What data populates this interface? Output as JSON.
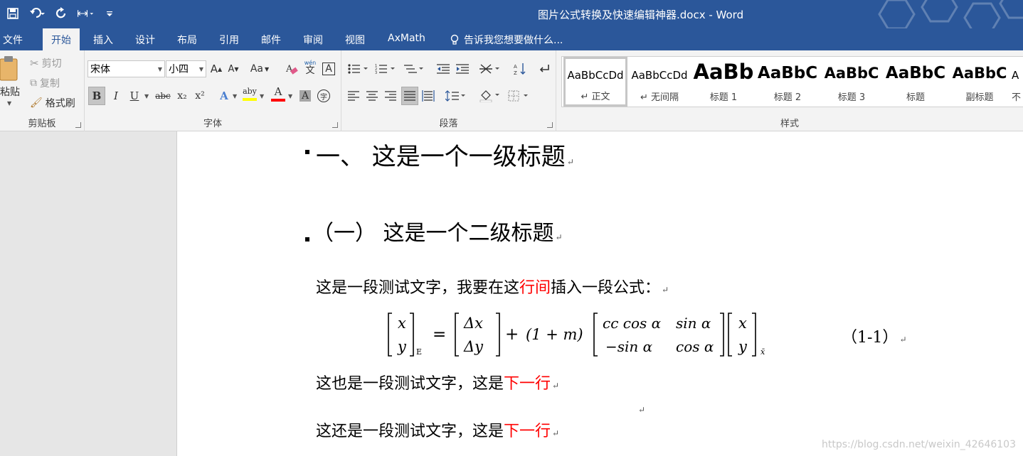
{
  "titlebar": {
    "doc_title": "图片公式转换及快速编辑神器.docx - Word",
    "qat": [
      "save-icon",
      "undo-icon",
      "redo-icon",
      "customize-icon"
    ]
  },
  "tabs": [
    {
      "label": "文件"
    },
    {
      "label": "开始",
      "active": true
    },
    {
      "label": "插入"
    },
    {
      "label": "设计"
    },
    {
      "label": "布局"
    },
    {
      "label": "引用"
    },
    {
      "label": "邮件"
    },
    {
      "label": "审阅"
    },
    {
      "label": "视图"
    },
    {
      "label": "AxMath"
    }
  ],
  "tell_me": "告诉我您想要做什么...",
  "clipboard": {
    "paste": "粘贴",
    "cut": "剪切",
    "copy": "复制",
    "format_painter": "格式刷",
    "label": "剪贴板"
  },
  "font": {
    "name": "宋体",
    "size": "小四",
    "label": "字体",
    "bold": "B",
    "italic": "I",
    "underline": "U",
    "strike": "abc",
    "subscript": "x₂",
    "superscript": "x²",
    "grow": "A",
    "shrink": "A",
    "case": "Aa",
    "phonetic_top": "wén",
    "phonetic_bottom": "文",
    "border_char": "A",
    "text_effect": "A",
    "highlight": "aby",
    "font_color": "A",
    "shade": "A",
    "enclose": "字",
    "highlight_color": "#ffff00",
    "font_color_value": "#ff0000"
  },
  "paragraph": {
    "label": "段落"
  },
  "styles": {
    "label": "样式",
    "items": [
      {
        "sample": "AaBbCcDd",
        "name": "↵ 正文",
        "selected": true
      },
      {
        "sample": "AaBbCcDd",
        "name": "↵ 无间隔"
      },
      {
        "sample": "AaBb",
        "name": "标题 1"
      },
      {
        "sample": "AaBbC",
        "name": "标题 2"
      },
      {
        "sample": "AaBbC",
        "name": "标题 3"
      },
      {
        "sample": "AaBbC",
        "name": "标题"
      },
      {
        "sample": "AaBbC",
        "name": "副标题"
      },
      {
        "sample": "A",
        "name": "不"
      }
    ]
  },
  "document": {
    "heading1": "一、 这是一个一级标题",
    "heading2": "（一） 这是一个二级标题",
    "para1": {
      "before": "这是一段测试文字，我要在这",
      "highlight": "行间",
      "after": "插入一段公式："
    },
    "equation_number": "（1-1）",
    "para2": {
      "before": "这也是一段测试文字，这是",
      "highlight": "下一行"
    },
    "para3": {
      "before": "这还是一段测试文字，这是",
      "highlight": "下一行"
    },
    "paragraph_mark": "↵"
  },
  "formula": {
    "lhs_vector": [
      "x",
      "y"
    ],
    "lhs_subscript": "E",
    "equals": "=",
    "delta_vector": [
      "Δx",
      "Δy"
    ],
    "plus": "+",
    "factor": "(1 + m)",
    "matrix": [
      [
        "cc cos α",
        "sin α"
      ],
      [
        "−sin α",
        "cos α"
      ]
    ],
    "rhs_vector": [
      "x",
      "y"
    ],
    "rhs_subscript": "x̄"
  },
  "watermark": "https://blog.csdn.net/weixin_42646103"
}
